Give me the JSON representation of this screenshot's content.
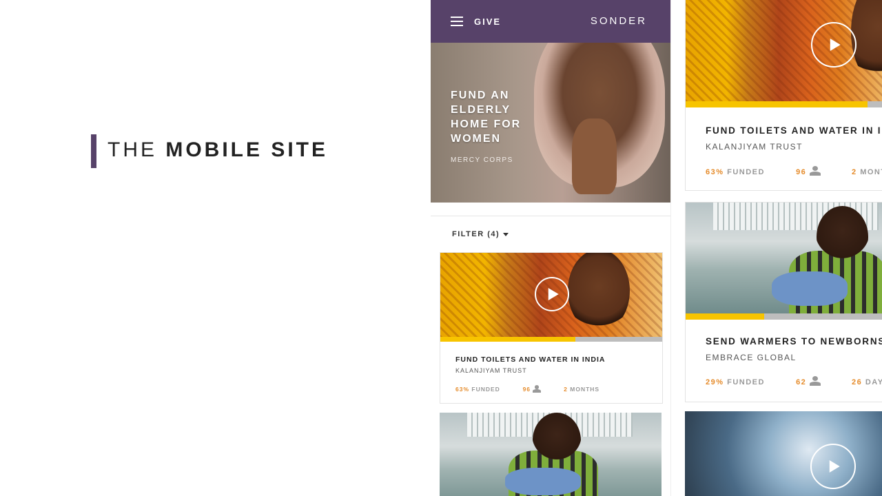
{
  "colors": {
    "brand": "#574269",
    "accent": "#f7c400",
    "stat": "#e58b2a"
  },
  "heading": {
    "light": "THE",
    "bold": "MOBILE SITE"
  },
  "nav": {
    "menu_icon": "hamburger-icon",
    "give": "GIVE",
    "logo": "SONDER"
  },
  "hero": {
    "title": "FUND AN ELDERLY HOME FOR WOMEN",
    "org": "MERCY CORPS"
  },
  "filter": {
    "label": "FILTER (4)",
    "icon": "caret-down-icon"
  },
  "cards": [
    {
      "title": "FUND TOILETS AND WATER IN INDIA",
      "org": "KALANJIYAM TRUST",
      "funded_pct": "63%",
      "funded_label": "FUNDED",
      "donors": "96",
      "time_num": "2",
      "time_label": "MONTHS",
      "progress": 0.63,
      "has_video": true
    },
    {
      "title": "SEND WARMERS TO NEWBORNS",
      "org": "EMBRACE GLOBAL",
      "funded_pct": "29%",
      "funded_label": "FUNDED",
      "donors": "62",
      "time_num": "26",
      "time_label": "DAYS",
      "progress": 0.29,
      "has_video": false
    }
  ]
}
